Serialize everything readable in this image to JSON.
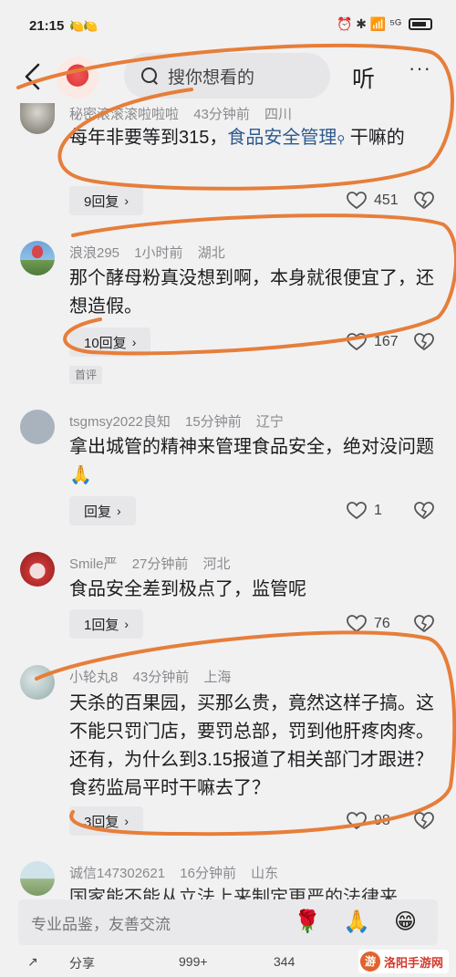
{
  "status_bar": {
    "time": "21:15",
    "extra_icons": "🍋🍋",
    "right_icons": "⏰ ✱ 📶 ⁵ᴳ"
  },
  "nav": {
    "search_placeholder": "搜你想看的",
    "listen_label": "听",
    "more_label": "···"
  },
  "comments": [
    {
      "user": "秘密滚滚滚啦啦啦",
      "time": "43分钟前",
      "location": "四川",
      "text_before": "每年非要等到315，",
      "link": "食品安全管理",
      "text_after": " 干嘛的",
      "reply_label": "9回复",
      "likes": "451"
    },
    {
      "user": "浪浪295",
      "time": "1小时前",
      "location": "湖北",
      "text": "那个酵母粉真没想到啊，本身就很便宜了，还想造假。",
      "reply_label": "10回复",
      "likes": "167",
      "tag": "首评"
    },
    {
      "user": "tsgmsy2022良知",
      "time": "15分钟前",
      "location": "辽宁",
      "text": "拿出城管的精神来管理食品安全，绝对没问题🙏",
      "reply_label": "回复",
      "likes": "1"
    },
    {
      "user": "Smile严",
      "time": "27分钟前",
      "location": "河北",
      "text": "食品安全差到极点了，监管呢",
      "reply_label": "1回复",
      "likes": "76"
    },
    {
      "user": "小轮丸8",
      "time": "43分钟前",
      "location": "上海",
      "text": "天杀的百果园，买那么贵，竟然这样子搞。这不能只罚门店，要罚总部，罚到他肝疼肉疼。还有，为什么到3.15报道了相关部门才跟进？食药监局平时干嘛去了？",
      "reply_label": "3回复",
      "likes": "98"
    },
    {
      "user": "诚信147302621",
      "time": "16分钟前",
      "location": "山东",
      "text": "国家能不能从立法上来制定更严的法律来"
    }
  ],
  "bottom": {
    "placeholder": "专业品鉴，友善交流",
    "emojis": [
      "🌹",
      "🙏",
      "😁"
    ],
    "bar_left": "分享",
    "bar_mid": "999+",
    "bar_right": "344"
  },
  "watermark": {
    "logo_text": "游",
    "text": "洛阳手游网"
  },
  "colors": {
    "annotation": "#e67e3a",
    "link": "#2e5a8e",
    "background": "#f1f1f2"
  }
}
